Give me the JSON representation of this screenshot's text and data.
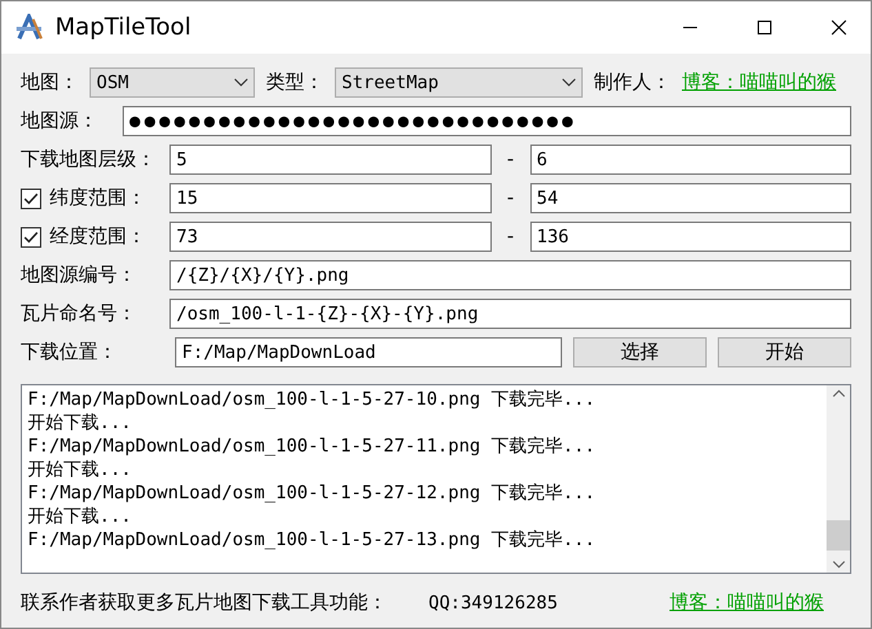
{
  "window": {
    "title": "MapTileTool"
  },
  "selectors": [
    {
      "label": "地图：",
      "value": "OSM"
    },
    {
      "label": "类型：",
      "value": "StreetMap"
    }
  ],
  "author": {
    "label": "制作人：",
    "link": "博客：喵喵叫的猴"
  },
  "source": {
    "label": "地图源：",
    "value": "●●●●●●●●●●●●●●●●●●●●●●●●●●●●●●"
  },
  "ranges": [
    {
      "kind": "plain",
      "label": "下载地图层级：",
      "from": "5",
      "separator": "-",
      "to": "6"
    },
    {
      "kind": "checkbox",
      "checked": true,
      "label": "纬度范围：",
      "from": "15",
      "separator": "-",
      "to": "54"
    },
    {
      "kind": "checkbox",
      "checked": true,
      "label": "经度范围：",
      "from": "73",
      "separator": "-",
      "to": "136"
    }
  ],
  "paths": [
    {
      "label": "地图源编号：",
      "value": "/{Z}/{X}/{Y}.png"
    },
    {
      "label": "瓦片命名号：",
      "value": "/osm_100-l-1-{Z}-{X}-{Y}.png"
    }
  ],
  "download": {
    "label": "下载位置：",
    "value": "F:/Map/MapDownLoad",
    "buttons": [
      "选择",
      "开始"
    ]
  },
  "log": {
    "lines": [
      "F:/Map/MapDownLoad/osm_100-l-1-5-27-10.png 下载完毕...",
      "开始下载...",
      "F:/Map/MapDownLoad/osm_100-l-1-5-27-11.png 下载完毕...",
      "开始下载...",
      "F:/Map/MapDownLoad/osm_100-l-1-5-27-12.png 下载完毕...",
      "开始下载...",
      "F:/Map/MapDownLoad/osm_100-l-1-5-27-13.png 下载完毕..."
    ]
  },
  "footer": {
    "text": "联系作者获取更多瓦片地图下载工具功能：",
    "qq": "QQ:349126285",
    "link": "博客：喵喵叫的猴"
  }
}
